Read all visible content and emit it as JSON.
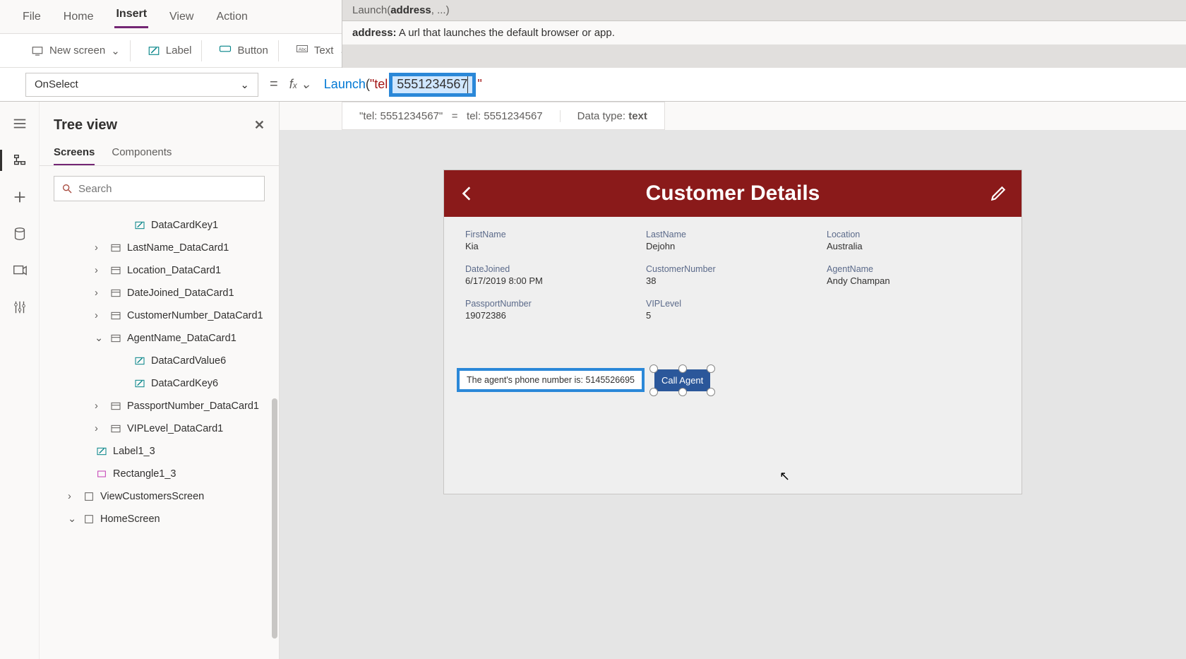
{
  "menu": {
    "file": "File",
    "home": "Home",
    "insert": "Insert",
    "view": "View",
    "action": "Action"
  },
  "ribbon": {
    "new_screen": "New screen",
    "label": "Label",
    "button": "Button",
    "text": "Text"
  },
  "formula_help": {
    "signature_fn": "Launch(",
    "signature_arg": "address",
    "signature_rest": ", ...)",
    "desc_label": "address:",
    "desc_text": "A url that launches the default browser or app."
  },
  "property_selector": "OnSelect",
  "formula": {
    "fn": "Launch",
    "open": "(",
    "q": "\"",
    "prefix": "tel",
    "highlight": "5551234567",
    "suffix": "\""
  },
  "result": {
    "lhs": "\"tel: 5551234567\"",
    "eq": "=",
    "rhs": "tel: 5551234567",
    "dtype_label": "Data type:",
    "dtype": "text"
  },
  "tree": {
    "title": "Tree view",
    "tab_screens": "Screens",
    "tab_components": "Components",
    "search_placeholder": "Search",
    "items": [
      {
        "indent": "indent-3",
        "icon": "edit",
        "label": "DataCardKey1"
      },
      {
        "indent": "indent-2",
        "chev": ">",
        "icon": "card",
        "label": "LastName_DataCard1"
      },
      {
        "indent": "indent-2",
        "chev": ">",
        "icon": "card",
        "label": "Location_DataCard1"
      },
      {
        "indent": "indent-2",
        "chev": ">",
        "icon": "card",
        "label": "DateJoined_DataCard1"
      },
      {
        "indent": "indent-2",
        "chev": ">",
        "icon": "card",
        "label": "CustomerNumber_DataCard1"
      },
      {
        "indent": "indent-2",
        "chev": "v",
        "icon": "card",
        "label": "AgentName_DataCard1"
      },
      {
        "indent": "indent-3",
        "icon": "edit",
        "label": "DataCardValue6"
      },
      {
        "indent": "indent-3",
        "icon": "edit",
        "label": "DataCardKey6"
      },
      {
        "indent": "indent-2",
        "chev": ">",
        "icon": "card",
        "label": "PassportNumber_DataCard1"
      },
      {
        "indent": "indent-2",
        "chev": ">",
        "icon": "card",
        "label": "VIPLevel_DataCard1"
      },
      {
        "indent": "indent-1",
        "icon": "edit",
        "label": "Label1_3"
      },
      {
        "indent": "indent-1",
        "icon": "rect",
        "label": "Rectangle1_3"
      },
      {
        "indent": "indent-0",
        "chev": ">",
        "icon": "screen",
        "label": "ViewCustomersScreen"
      },
      {
        "indent": "indent-0",
        "chev": "v",
        "icon": "screen",
        "label": "HomeScreen"
      }
    ]
  },
  "app": {
    "title": "Customer Details",
    "fields": [
      {
        "label": "FirstName",
        "value": "Kia"
      },
      {
        "label": "LastName",
        "value": "Dejohn"
      },
      {
        "label": "Location",
        "value": "Australia"
      },
      {
        "label": "DateJoined",
        "value": "6/17/2019 8:00 PM"
      },
      {
        "label": "CustomerNumber",
        "value": "38"
      },
      {
        "label": "AgentName",
        "value": "Andy Champan"
      },
      {
        "label": "PassportNumber",
        "value": "19072386"
      },
      {
        "label": "VIPLevel",
        "value": "5"
      }
    ],
    "agent_label": "The agent's phone number is:",
    "agent_phone": "5145526695",
    "call_button": "Call Agent"
  }
}
